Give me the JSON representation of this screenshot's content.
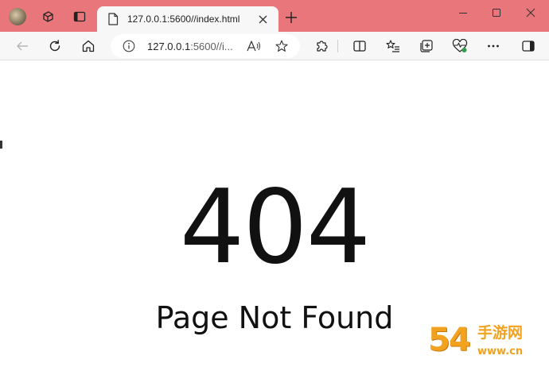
{
  "browser": {
    "tab": {
      "title": "127.0.0.1:5600//index.html"
    },
    "address_bar": {
      "host": "127.0.0.1",
      "rest": ":5600//i..."
    },
    "accent_color": "#e8767a",
    "icons": {
      "avatar": "profile-avatar",
      "workspaces": "workspaces-icon",
      "tab_actions": "tab-actions-icon",
      "tab_page": "document-icon",
      "tab_close": "close-icon",
      "new_tab": "plus-icon",
      "minimize": "minimize-icon",
      "maximize": "maximize-icon",
      "window_close": "close-icon",
      "back": "back-arrow-icon",
      "refresh": "refresh-icon",
      "home": "home-icon",
      "site_info": "info-icon",
      "read_aloud": "read-aloud-icon",
      "favorite": "star-icon",
      "extensions": "puzzle-icon",
      "split_screen": "split-screen-icon",
      "favorites": "favorites-list-icon",
      "collections": "collections-icon",
      "browser_essentials": "heart-pulse-icon",
      "more": "more-dots-icon",
      "copilot": "sidebar-icon"
    }
  },
  "page": {
    "error_code": "404",
    "error_message": "Page Not Found"
  },
  "watermark": {
    "digits": "54",
    "chinese_text": "手游网",
    "domain": "www.cn",
    "color": "#f2a21e"
  }
}
